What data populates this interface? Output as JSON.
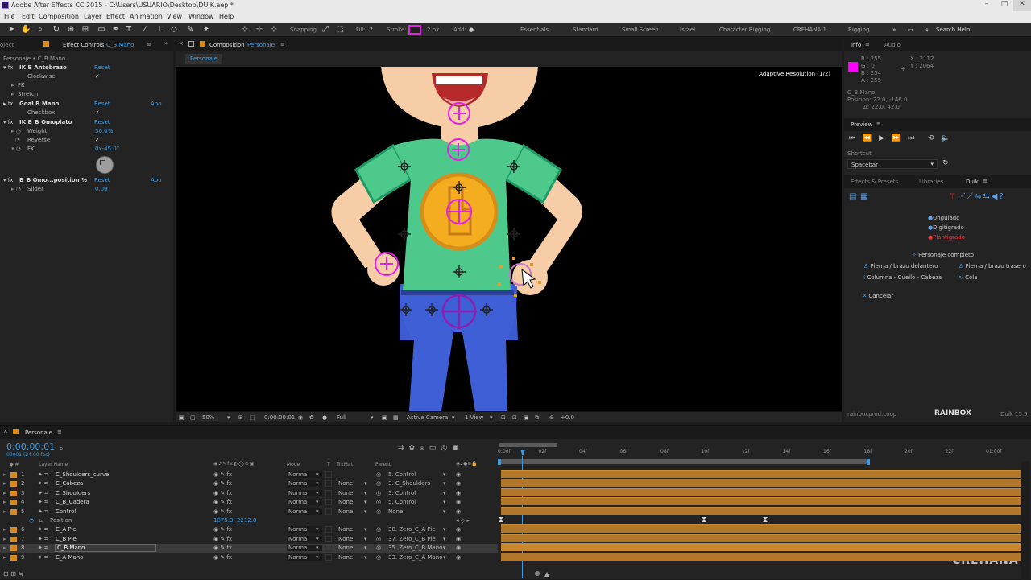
{
  "app": {
    "title": "Adobe After Effects CC 2015 - C:\\Users\\USUARIO\\Desktop\\DUIK.aep *"
  },
  "menu": [
    "File",
    "Edit",
    "Composition",
    "Layer",
    "Effect",
    "Animation",
    "View",
    "Window",
    "Help"
  ],
  "toolbar": {
    "snapping": "Snapping",
    "fill": "Fill:",
    "stroke": "Stroke:",
    "stroke_px": "2 px",
    "add": "Add:",
    "workspaces": [
      "Essentials",
      "Standard",
      "Small Screen",
      "Israel",
      "Character Rigging",
      "CREHANA 1",
      "Rigging"
    ],
    "search": "Search Help",
    "accent": "#e81ee8"
  },
  "left_panel": {
    "tab_project": "oject",
    "tab": "Effect Controls",
    "layer": "C_B Mano",
    "path": "Personaje • C_B Mano",
    "effects": [
      {
        "name": "IK B Antebrazo",
        "reset": "Reset"
      },
      {
        "name": "Clockwise",
        "value": "✓"
      },
      {
        "name": "FK"
      },
      {
        "name": "Stretch"
      },
      {
        "name": "Goal B Mano",
        "reset": "Reset",
        "about": "Abo"
      },
      {
        "name": "Checkbox",
        "value": "✓"
      },
      {
        "name": "IK B_B Omoplato",
        "reset": "Reset"
      },
      {
        "name": "Weight",
        "value": "50.0%"
      },
      {
        "name": "Reverse",
        "value": "✓"
      },
      {
        "name": "FK",
        "value": "0x-45.0°"
      },
      {
        "name": "B_B Omo...position %",
        "reset": "Reset",
        "about": "Abo"
      },
      {
        "name": "Slider",
        "value": "0.00"
      }
    ]
  },
  "composition": {
    "tab": "Composition",
    "name": "Personaje",
    "subtab": "Personaje",
    "adaptive": "Adaptive Resolution (1/2)",
    "zoom": "50%",
    "time": "0:00:00:01",
    "quality": "Full",
    "camera": "Active Camera",
    "views": "1 View",
    "exposure": "+0.0"
  },
  "info": {
    "tab": "Info",
    "tab2": "Audio",
    "r": "R : 255",
    "g": "G : 0",
    "b": "B : 254",
    "a": "A : 255",
    "x": "X : 2112",
    "y": "Y : 2064",
    "layer": "C_B Mano",
    "position": "Position: 22.0, -146.0",
    "delta": "Δ: 22.0, 42.0",
    "swatch": "#ff00fe"
  },
  "preview": {
    "tab": "Preview",
    "shortcut_label": "Shortcut",
    "shortcut": "Spacebar"
  },
  "duik": {
    "tabs": [
      "Effects & Presets",
      "Libraries",
      "Duik"
    ],
    "options": [
      "Ungulado",
      "Digitigrado",
      "Plantigrado"
    ],
    "complete": "Personaje completo",
    "buttons": [
      "Pierna / brazo delantero",
      "Pierna / brazo trasero",
      "Columna - Cuello - Cabeza",
      "Cola"
    ],
    "cancel": "Cancelar",
    "site": "rainboxprod.coop",
    "brand": "RAINBOX",
    "version": "Duik 15.5"
  },
  "timeline": {
    "tab": "Personaje",
    "time": "0:00:00:01",
    "fps": "00001 (24.00 fps)",
    "cols": {
      "layer": "Layer Name",
      "mode": "Mode",
      "t": "T",
      "trkmat": "TrkMat",
      "parent": "Parent"
    },
    "ticks": [
      "0:00f",
      "02f",
      "04f",
      "06f",
      "08f",
      "10f",
      "12f",
      "14f",
      "16f",
      "18f",
      "20f",
      "22f",
      "01:00f"
    ],
    "layers": [
      {
        "n": "1",
        "name": "C_Shoulders_curve",
        "mode": "Normal",
        "trk": "",
        "parent": "5. Control"
      },
      {
        "n": "2",
        "name": "C_Cabeza",
        "mode": "Normal",
        "trk": "None",
        "parent": "3. C_Shoulders"
      },
      {
        "n": "3",
        "name": "C_Shoulders",
        "mode": "Normal",
        "trk": "None",
        "parent": "5. Control"
      },
      {
        "n": "4",
        "name": "C_B_Cadera",
        "mode": "Normal",
        "trk": "None",
        "parent": "5. Control"
      },
      {
        "n": "5",
        "name": "Control",
        "mode": "Normal",
        "trk": "None",
        "parent": "None"
      },
      {
        "n": "",
        "name": "Position",
        "value": "1875.3, 2212.8"
      },
      {
        "n": "6",
        "name": "C_A Pie",
        "mode": "Normal",
        "trk": "None",
        "parent": "38. Zero_C_A Pie"
      },
      {
        "n": "7",
        "name": "C_B Pie",
        "mode": "Normal",
        "trk": "None",
        "parent": "37. Zero_C_B Pie"
      },
      {
        "n": "8",
        "name": "C_B Mano",
        "mode": "Normal",
        "trk": "None",
        "parent": "35. Zero_C_B Mano"
      },
      {
        "n": "9",
        "name": "C_A Mano",
        "mode": "Normal",
        "trk": "None",
        "parent": "33. Zero_C_A Mano"
      }
    ]
  },
  "watermark": "CREHANA"
}
